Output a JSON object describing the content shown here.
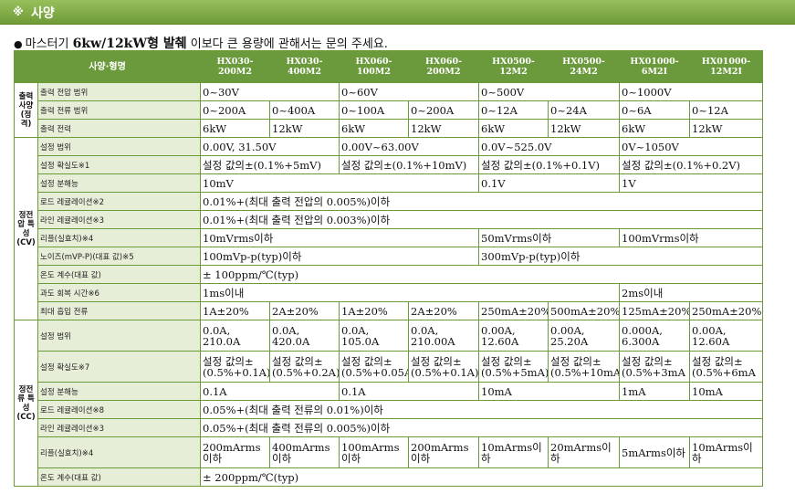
{
  "header": {
    "title": "사양",
    "title_mark": "※"
  },
  "notice": {
    "part1": "마스터기",
    "part2": "6kw/12kW",
    "part3": "형 발췌",
    "part4": " 이보다 큰 용량에 관해서는 문의 주세요."
  },
  "table": {
    "head_label": "사양·형명",
    "models": [
      "HX030-200M2",
      "HX030-400M2",
      "HX060-100M2",
      "HX060-200M2",
      "HX0500-12M2",
      "HX0500-24M2",
      "HX01000-6M2I",
      "HX01000-12M2I"
    ],
    "groups": {
      "output": "출력 사양 (정격)",
      "cv": "정전압 특성 (CV)",
      "cc": "정전류 특성 (CC)"
    },
    "output": {
      "voltage_label": "출력 전압 범위",
      "voltage": [
        "0~30V",
        "0~60V",
        "0~500V",
        "0~1000V"
      ],
      "current_label": "출력 전류 범위",
      "current": [
        "0~200A",
        "0~400A",
        "0~100A",
        "0~200A",
        "0~12A",
        "0~24A",
        "0~6A",
        "0~12A"
      ],
      "power_label": "출력 전력",
      "power": [
        "6kW",
        "12kW",
        "6kW",
        "12kW",
        "6kW",
        "12kW",
        "6kW",
        "12kW"
      ]
    },
    "cv": {
      "setting_range_label": "설정 범위",
      "setting_range": [
        "0.00V, 31.50V",
        "0.00V~63.00V",
        "0.0V~525.0V",
        "0V~1050V"
      ],
      "setting_accuracy_label": "설정 확실도※1",
      "setting_accuracy": [
        "설정 값의±(0.1%+5mV)",
        "설정 값의±(0.1%+10mV)",
        "설정 값의±(0.1%+0.1V)",
        "설정 값의±(0.1%+0.2V)"
      ],
      "resolution_label": "설정 분해능",
      "resolution": [
        "10mV",
        "0.1V",
        "1V"
      ],
      "load_reg_label": "로드 레귤레이션※2",
      "load_reg": "0.01%+(최대 출력 전압의 0.005%)이하",
      "line_reg_label": "라인 레귤레이션※3",
      "line_reg": "0.01%+(최대 출력 전압의 0.003%)이하",
      "ripple_label": "리플(실효치)※4",
      "ripple": [
        "10mVrms이하",
        "50mVrms이하",
        "100mVrms이하"
      ],
      "noise_label": "노이즈(mVP-P)(대표 값)※5",
      "noise": [
        "100mVp-p(typ)이하",
        "300mVp-p(typ)이하"
      ],
      "temp_label": "온도 계수(대표 값)",
      "temp": "± 100ppm/℃(typ)",
      "transient_label": "과도 회복 시간※6",
      "transient": [
        "1ms이내",
        "2ms이내"
      ],
      "inrush_label": "최대 흡입 전류",
      "inrush": [
        "1A±20%",
        "2A±20%",
        "1A±20%",
        "2A±20%",
        "250mA±20%",
        "500mA±20%",
        "125mA±20%",
        "250mA±20%"
      ]
    },
    "cc": {
      "setting_range_label": "설정 범위",
      "setting_range": [
        "0.0A, 210.0A",
        "0.0A, 420.0A",
        "0.0A, 105.0A",
        "0.0A, 210.00A",
        "0.00A, 12.60A",
        "0.00A, 25.20A",
        "0.000A, 6.300A",
        "0.00A, 12.60A"
      ],
      "setting_accuracy_label": "설정 확실도※7",
      "setting_accuracy": [
        "설정 값의± (0.5%+0.1A)",
        "설정 값의± (0.5%+0.2A)",
        "설정 값의± (0.5%+0.05A)",
        "설정 값의± (0.5%+0.1A)",
        "설정 값의± (0.5%+5mA)",
        "설정 값의± (0.5%+10mA)",
        "설정 값의± (0.5%+3mA",
        "설정 값의± (0.5%+6mA"
      ],
      "resolution_label": "설정 분해능",
      "resolution": [
        "0.1A",
        "0.1A",
        "10mA",
        "1mA",
        "10mA"
      ],
      "load_reg_label": "로드 레귤레이션※8",
      "load_reg": "0.05%+(최대 출력 전류의 0.01%)이하",
      "line_reg_label": "라인 레귤레이션※3",
      "line_reg": "0.05%+(최대 출력 전류의 0.005%)이하",
      "ripple_label": "리플(실효치)※4",
      "ripple": [
        "200mArms이하",
        "400mArms이하",
        "100mArms이하",
        "200mArms이하",
        "10mArms이하",
        "20mArms이하",
        "5mArms이하",
        "10mArms이하"
      ],
      "temp_label": "온도 계수(대표 값)",
      "temp": "± 200ppm/℃(typ)"
    }
  }
}
